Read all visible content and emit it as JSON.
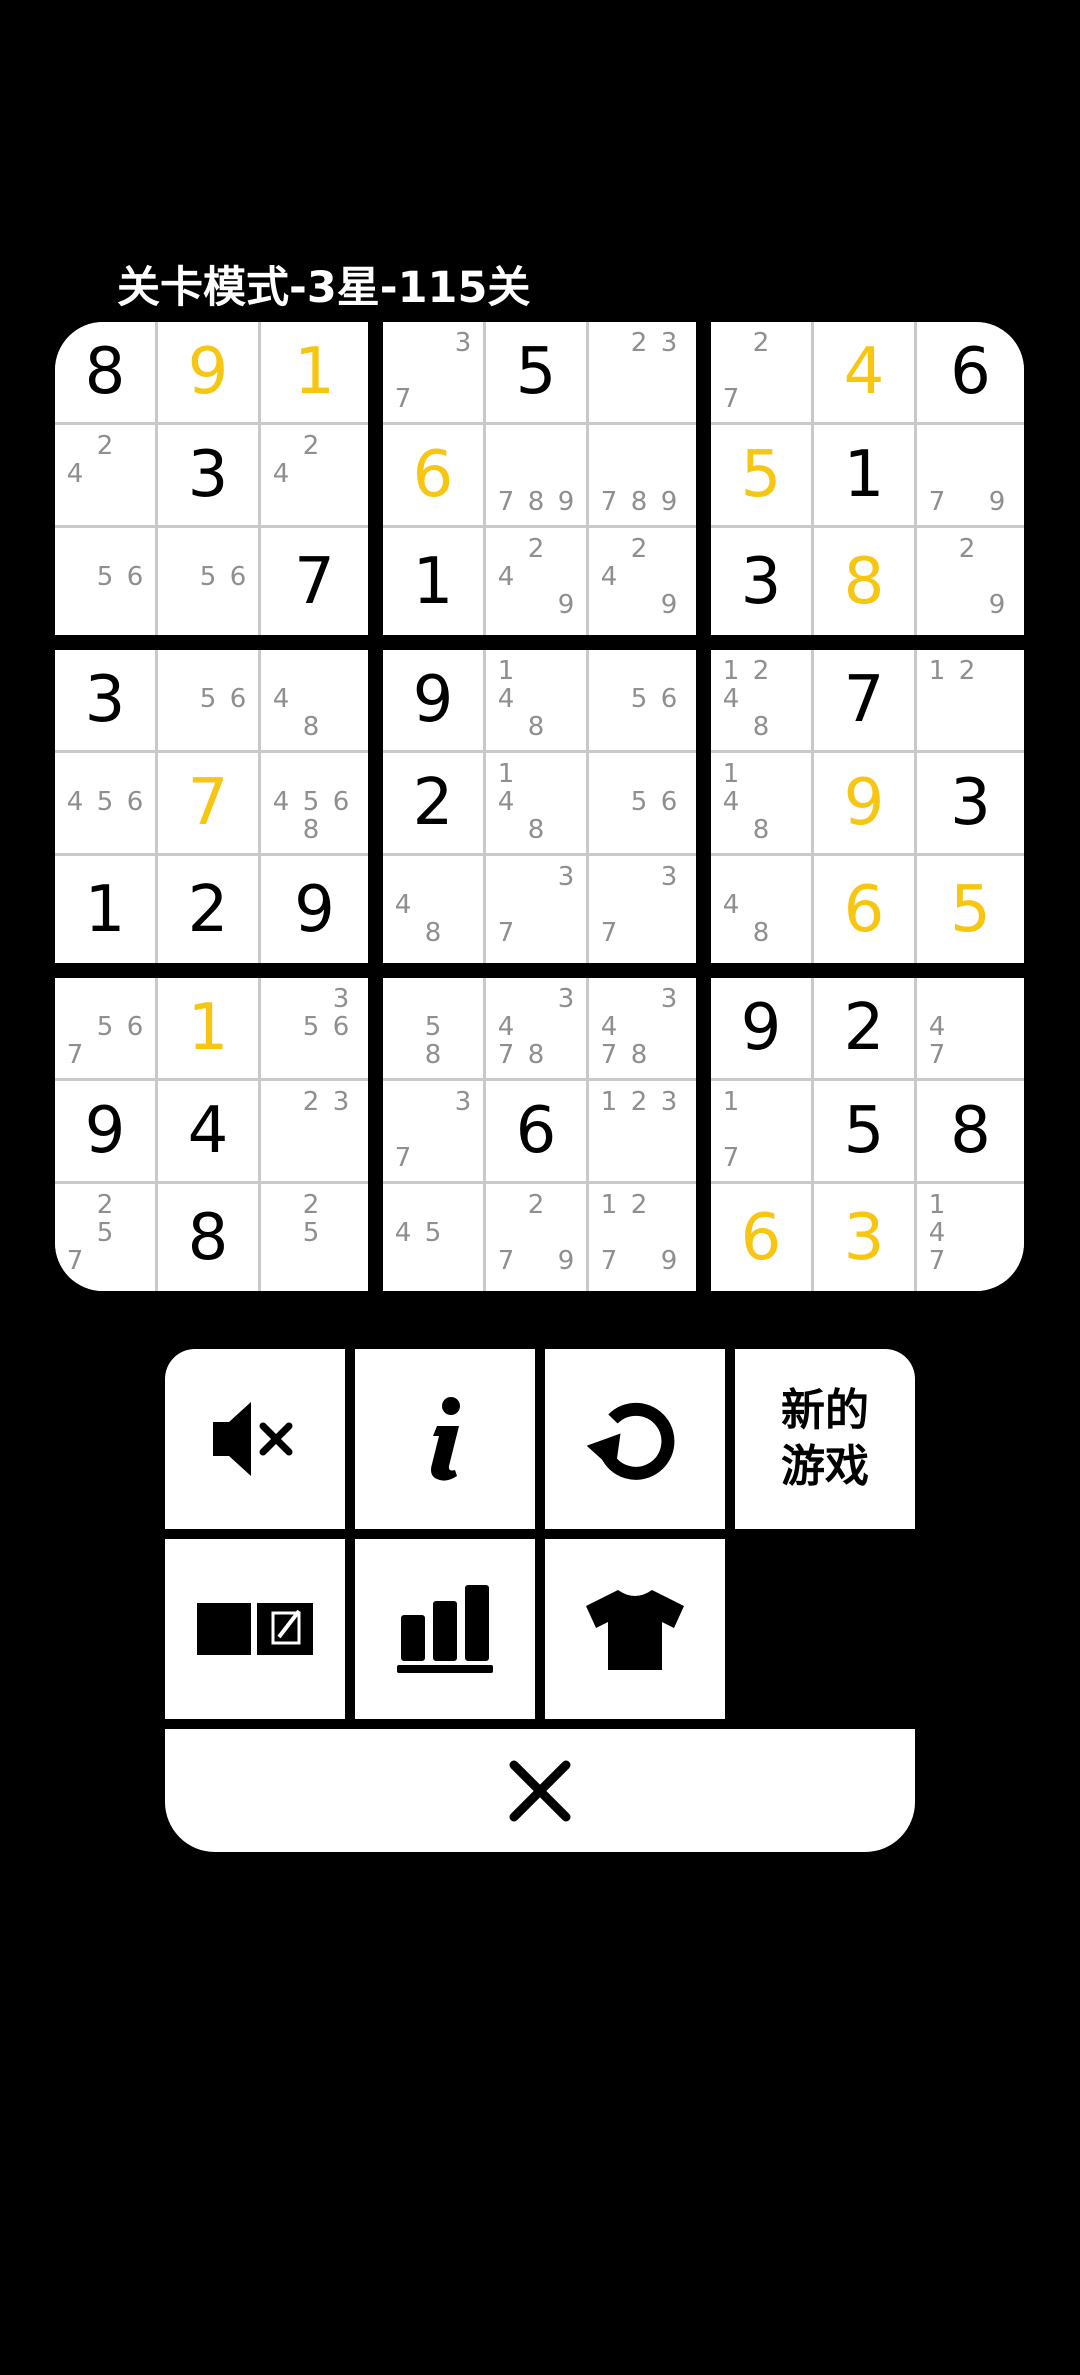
{
  "level_title": "关卡模式-3星-115关",
  "colors": {
    "given": "#000000",
    "user": "#f7c613",
    "candidate": "#8f8f8f",
    "background": "#000000"
  },
  "board": [
    [
      {
        "d": "8",
        "t": "given"
      },
      {
        "d": "9",
        "t": "user"
      },
      {
        "d": "1",
        "t": "user"
      },
      {
        "c": [
          3,
          7
        ]
      },
      {
        "d": "5",
        "t": "given"
      },
      {
        "c": [
          2,
          3
        ]
      },
      {
        "c": [
          2,
          7
        ]
      },
      {
        "d": "4",
        "t": "user"
      },
      {
        "d": "6",
        "t": "given"
      }
    ],
    [
      {
        "c": [
          2,
          4
        ]
      },
      {
        "d": "3",
        "t": "given"
      },
      {
        "c": [
          2,
          4
        ]
      },
      {
        "d": "6",
        "t": "user"
      },
      {
        "c": [
          7,
          8,
          9
        ]
      },
      {
        "c": [
          7,
          8,
          9
        ]
      },
      {
        "d": "5",
        "t": "user"
      },
      {
        "d": "1",
        "t": "given"
      },
      {
        "c": [
          7,
          9
        ]
      }
    ],
    [
      {
        "c": [
          5,
          6
        ]
      },
      {
        "c": [
          5,
          6
        ]
      },
      {
        "d": "7",
        "t": "given"
      },
      {
        "d": "1",
        "t": "given"
      },
      {
        "c": [
          2,
          4,
          9
        ]
      },
      {
        "c": [
          2,
          4,
          9
        ]
      },
      {
        "d": "3",
        "t": "given"
      },
      {
        "d": "8",
        "t": "user"
      },
      {
        "c": [
          2,
          9
        ]
      }
    ],
    [
      {
        "d": "3",
        "t": "given"
      },
      {
        "c": [
          5,
          6
        ]
      },
      {
        "c": [
          4,
          8
        ]
      },
      {
        "d": "9",
        "t": "given"
      },
      {
        "c": [
          1,
          4,
          8
        ]
      },
      {
        "c": [
          5,
          6
        ]
      },
      {
        "c": [
          1,
          2,
          4,
          8
        ]
      },
      {
        "d": "7",
        "t": "given"
      },
      {
        "c": [
          1,
          2
        ]
      }
    ],
    [
      {
        "c": [
          4,
          5,
          6
        ]
      },
      {
        "d": "7",
        "t": "user"
      },
      {
        "c": [
          4,
          5,
          6,
          8
        ]
      },
      {
        "d": "2",
        "t": "given"
      },
      {
        "c": [
          1,
          4,
          8
        ]
      },
      {
        "c": [
          5,
          6
        ]
      },
      {
        "c": [
          1,
          4,
          8
        ]
      },
      {
        "d": "9",
        "t": "user"
      },
      {
        "d": "3",
        "t": "given"
      }
    ],
    [
      {
        "d": "1",
        "t": "given"
      },
      {
        "d": "2",
        "t": "given"
      },
      {
        "d": "9",
        "t": "given"
      },
      {
        "c": [
          4,
          8
        ]
      },
      {
        "c": [
          3,
          7
        ]
      },
      {
        "c": [
          3,
          7
        ]
      },
      {
        "c": [
          4,
          8
        ]
      },
      {
        "d": "6",
        "t": "user"
      },
      {
        "d": "5",
        "t": "user"
      }
    ],
    [
      {
        "c": [
          5,
          6,
          7
        ]
      },
      {
        "d": "1",
        "t": "user"
      },
      {
        "c": [
          3,
          5,
          6
        ]
      },
      {
        "c": [
          5,
          8
        ]
      },
      {
        "c": [
          3,
          4,
          7,
          8
        ]
      },
      {
        "c": [
          3,
          4,
          7,
          8
        ]
      },
      {
        "d": "9",
        "t": "given"
      },
      {
        "d": "2",
        "t": "given"
      },
      {
        "c": [
          4,
          7
        ]
      }
    ],
    [
      {
        "d": "9",
        "t": "given"
      },
      {
        "d": "4",
        "t": "given"
      },
      {
        "c": [
          2,
          3
        ]
      },
      {
        "c": [
          3,
          7
        ]
      },
      {
        "d": "6",
        "t": "given"
      },
      {
        "c": [
          1,
          2,
          3
        ]
      },
      {
        "c": [
          1,
          7
        ]
      },
      {
        "d": "5",
        "t": "given"
      },
      {
        "d": "8",
        "t": "given"
      }
    ],
    [
      {
        "c": [
          2,
          5,
          7
        ]
      },
      {
        "d": "8",
        "t": "given"
      },
      {
        "c": [
          2,
          5
        ]
      },
      {
        "c": [
          4,
          5
        ]
      },
      {
        "c": [
          2,
          7,
          9
        ]
      },
      {
        "c": [
          1,
          2,
          7,
          9
        ]
      },
      {
        "d": "6",
        "t": "user"
      },
      {
        "d": "3",
        "t": "user"
      },
      {
        "c": [
          1,
          4,
          7
        ]
      }
    ]
  ],
  "buttons": {
    "row1": [
      {
        "name": "mute-button",
        "icon": "speaker-muted-icon"
      },
      {
        "name": "info-button",
        "icon": "info-icon"
      },
      {
        "name": "restart-button",
        "icon": "restart-icon"
      },
      {
        "name": "new-game-button",
        "label": "新的\n游戏"
      }
    ],
    "row2": [
      {
        "name": "notes-button",
        "icon": "notes-icon"
      },
      {
        "name": "stats-button",
        "icon": "bar-chart-icon"
      },
      {
        "name": "theme-button",
        "icon": "tshirt-icon"
      }
    ],
    "close": {
      "name": "close-button",
      "icon": "close-icon"
    }
  }
}
